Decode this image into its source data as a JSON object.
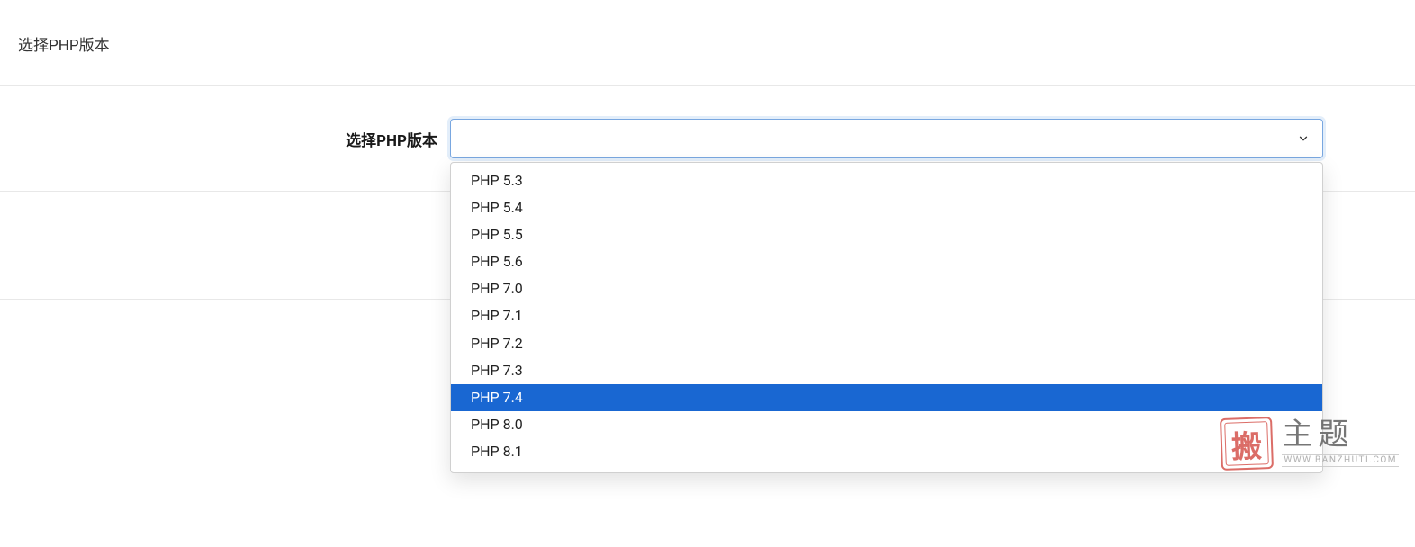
{
  "header": {
    "title": "选择PHP版本"
  },
  "form": {
    "label": "选择PHP版本",
    "selected_value": ""
  },
  "dropdown": {
    "options": [
      {
        "label": "PHP 5.3",
        "highlighted": false
      },
      {
        "label": "PHP 5.4",
        "highlighted": false
      },
      {
        "label": "PHP 5.5",
        "highlighted": false
      },
      {
        "label": "PHP 5.6",
        "highlighted": false
      },
      {
        "label": "PHP 7.0",
        "highlighted": false
      },
      {
        "label": "PHP 7.1",
        "highlighted": false
      },
      {
        "label": "PHP 7.2",
        "highlighted": false
      },
      {
        "label": "PHP 7.3",
        "highlighted": false
      },
      {
        "label": "PHP 7.4",
        "highlighted": true
      },
      {
        "label": "PHP 8.0",
        "highlighted": false
      },
      {
        "label": "PHP 8.1",
        "highlighted": false
      }
    ]
  },
  "icons": {
    "chevron_down": "chevron-down-icon"
  },
  "watermark": {
    "stamp_char": "搬",
    "main_text": "主题",
    "sub_text": "WWW.BANZHUTI.COM"
  }
}
